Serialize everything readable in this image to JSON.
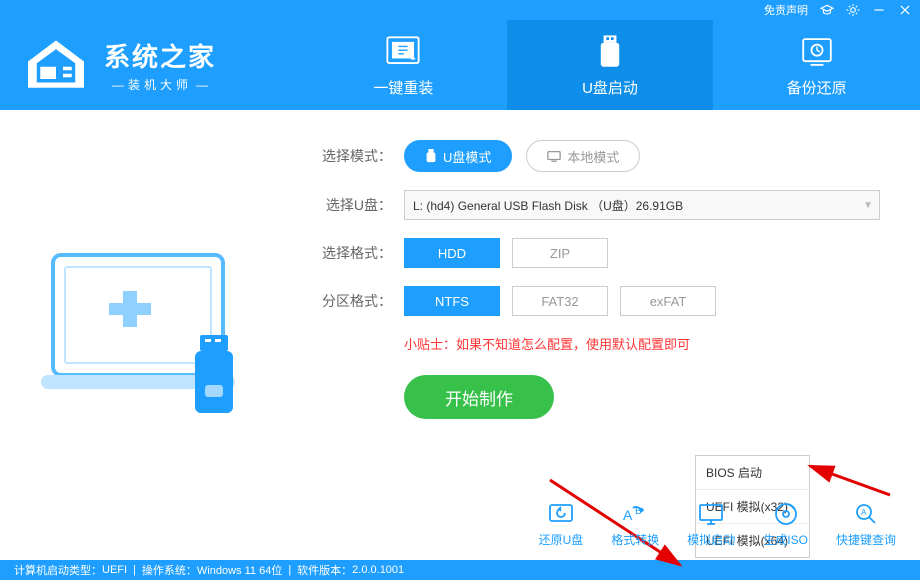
{
  "titlebar": {
    "disclaimer": "免责声明"
  },
  "logo": {
    "title": "系统之家",
    "subtitle": "装机大师"
  },
  "tabs": [
    {
      "label": "一键重装"
    },
    {
      "label": "U盘启动"
    },
    {
      "label": "备份还原"
    }
  ],
  "labels": {
    "mode": "选择模式：",
    "udisk": "选择U盘：",
    "format": "选择格式：",
    "partition": "分区格式："
  },
  "mode": {
    "usb": "U盘模式",
    "local": "本地模式"
  },
  "udisk_value": "L: (hd4) General USB Flash Disk （U盘）26.91GB",
  "format_opts": {
    "hdd": "HDD",
    "zip": "ZIP"
  },
  "partition_opts": {
    "ntfs": "NTFS",
    "fat32": "FAT32",
    "exfat": "exFAT"
  },
  "tip": "小贴士：如果不知道怎么配置，使用默认配置即可",
  "start": "开始制作",
  "popup": {
    "bios": "BIOS 启动",
    "uefi32": "UEFI 模拟(x32)",
    "uefi64": "UEFI 模拟(x64)"
  },
  "tools": {
    "restore": "还原U盘",
    "convert": "格式转换",
    "sim": "模拟启动",
    "iso": "生成ISO",
    "hotkey": "快捷键查询"
  },
  "status": {
    "boot_label": "计算机启动类型：",
    "boot_value": "UEFI",
    "os_label": "操作系统：",
    "os_value": "Windows 11 64位",
    "ver_label": "软件版本：",
    "ver_value": "2.0.0.1001"
  }
}
